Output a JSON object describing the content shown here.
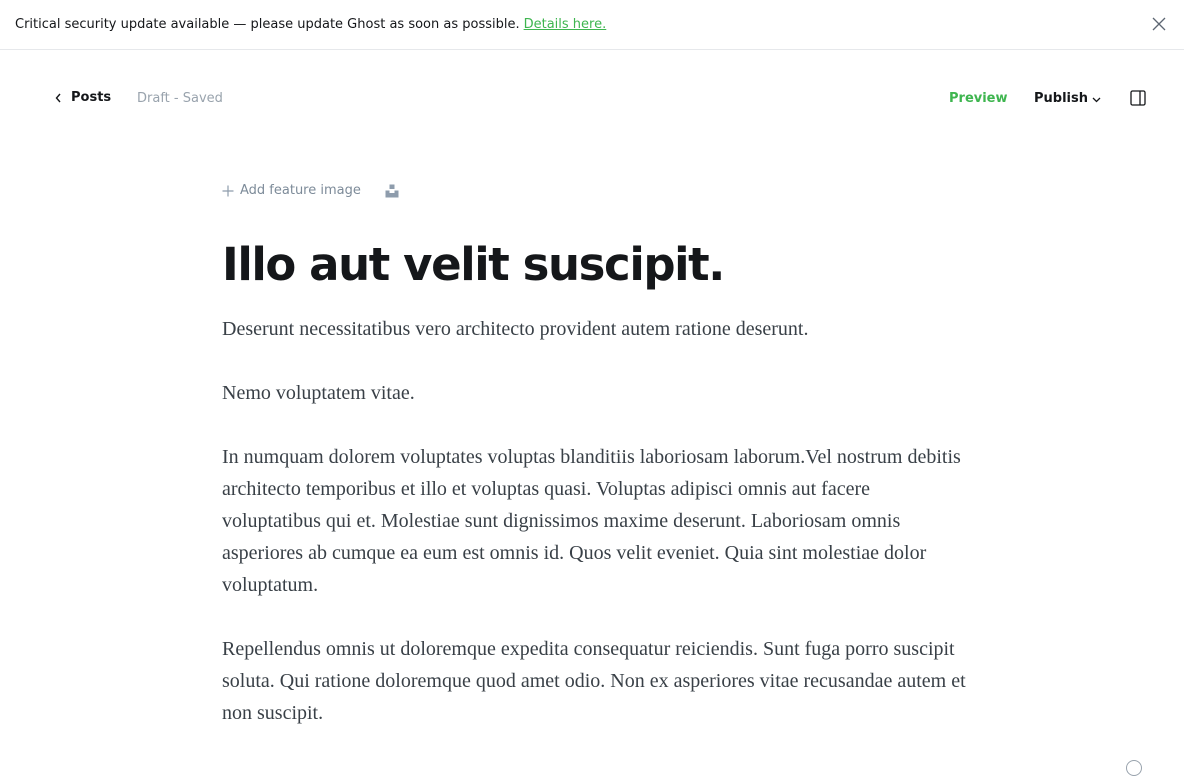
{
  "banner": {
    "message": "Critical security update available — please update Ghost as soon as possible.",
    "link_label": "Details here."
  },
  "header": {
    "back_label": "Posts",
    "status": "Draft - Saved",
    "preview_label": "Preview",
    "publish_label": "Publish"
  },
  "editor": {
    "add_feature_image_label": "Add feature image",
    "title": "Illo aut velit suscipit.",
    "paragraphs": [
      "Deserunt necessitatibus vero architecto provident autem ratione deserunt.",
      "Nemo voluptatem vitae.",
      "In numquam dolorem voluptates voluptas blanditiis laboriosam laborum.Vel nostrum debitis architecto temporibus et illo et voluptas quasi. Voluptas adipisci omnis aut facere voluptatibus qui et. Molestiae sunt dignissimos maxime deserunt. Laboriosam omnis asperiores ab cumque ea eum est omnis id. Quos velit eveniet. Quia sint molestiae dolor voluptatum.",
      "Repellendus omnis ut doloremque expedita consequatur reiciendis. Sunt fuga porro suscipit soluta. Qui ratione doloremque quod amet odio. Non ex asperiores vitae recusandae autem et non suscipit."
    ]
  },
  "icons": {
    "banner_close": "close-icon",
    "back": "chevron-left-icon",
    "publish_dropdown": "chevron-down-icon",
    "sidebar": "sidebar-panel-icon",
    "add": "plus-icon",
    "unsplash": "unsplash-icon",
    "help": "help-icon"
  },
  "colors": {
    "accent": "#3eb54f",
    "text": "#15171a",
    "muted": "#99a3ad",
    "body_text": "#394047"
  }
}
